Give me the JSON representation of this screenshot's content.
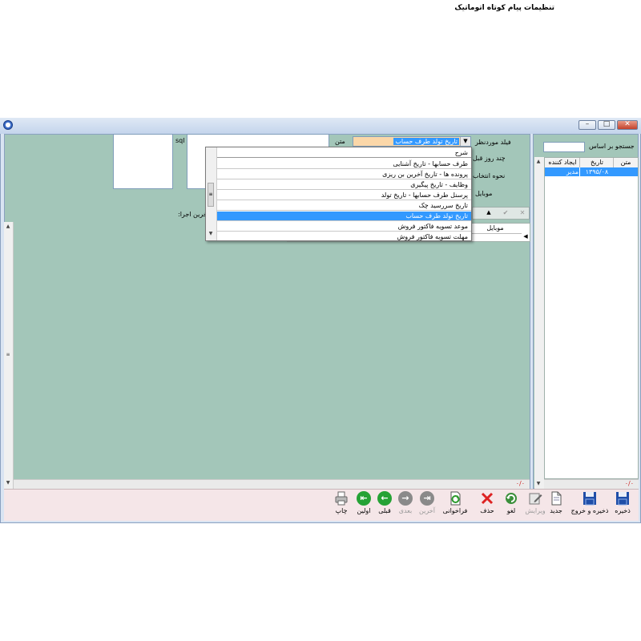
{
  "window": {
    "title": "تنظیمات پیام کوتاه اتوماتیک",
    "controls": {
      "minimize": "–",
      "restore": "□",
      "close": "✕"
    }
  },
  "form": {
    "field_label": "فیلد موردنظر",
    "days_before_label": "چند روز قبل",
    "selection_mode_label": "نحوه انتخاب",
    "mobile_label": "موبایل",
    "text_label": "متن",
    "sql_label": "sql",
    "last_run_label": "آخرین اجرا:",
    "selected_field_value": "تاریخ تولد طرف حساب"
  },
  "dropdown": {
    "header": "شرح",
    "items": [
      "طرف حسابها - تاریخ آشنایی",
      "پرونده ها - تاریخ آخرین بن ریزی",
      "وظایف - تاریخ پیگیری",
      "پرسنل طرف حسابها - تاریخ تولد",
      "تاریخ سررسید چک",
      "تاریخ تولد طرف حساب",
      "موعد تسویه فاکتور فروش",
      "مهلت تسویه فاکتور فروش"
    ],
    "selected_index": 5
  },
  "mobile_grid": {
    "header": "موبایل"
  },
  "search": {
    "label": "جستجو بر اساس",
    "value": ""
  },
  "right_grid": {
    "headers": [
      "متن",
      "تاریخ",
      "ایجاد کننده"
    ],
    "rows": [
      {
        "text": "",
        "date": "۱۳۹۵/۰۸",
        "creator": "مدیر"
      }
    ]
  },
  "status": {
    "left_counter": "۰/۰",
    "right_counter": "۰/۰"
  },
  "toolbar": {
    "save": "ذخیره",
    "save_exit": "ذخیره و خروج",
    "new": "جدید",
    "edit": "ویرایش",
    "cancel": "لغو",
    "delete": "حذف",
    "fetch": "فراخوانی",
    "last": "آخرین",
    "next": "بعدی",
    "prev": "قبلی",
    "first": "اولین",
    "print": "چاپ"
  },
  "colors": {
    "panel": "#a3c6b9",
    "highlight": "#3399ff",
    "field_highlight": "#fbd7a8",
    "toolbar_bg": "#f5e6e8"
  }
}
